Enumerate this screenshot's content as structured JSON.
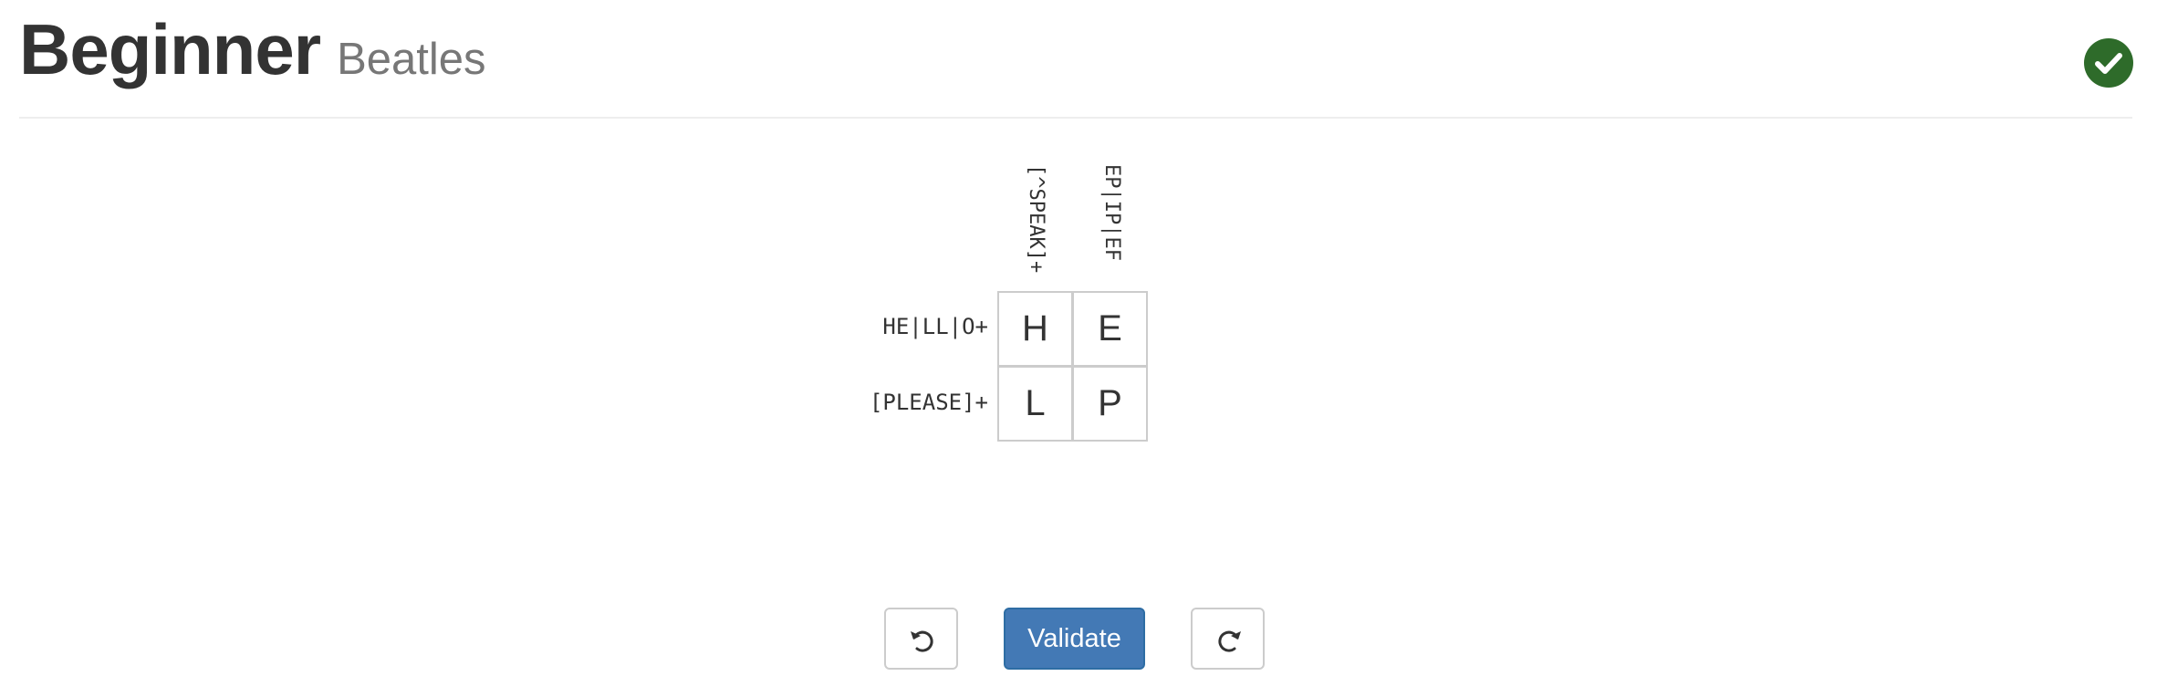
{
  "header": {
    "title": "Beginner",
    "subtitle": "Beatles",
    "status_icon": "check-circle-icon",
    "status_color": "#2e6b2a"
  },
  "puzzle": {
    "column_clues": [
      "[^SPEAK]+",
      "EP|IP|EF"
    ],
    "row_clues": [
      "HE|LL|O+",
      "[PLEASE]+"
    ],
    "cells": [
      [
        "H",
        "E"
      ],
      [
        "L",
        "P"
      ]
    ]
  },
  "controls": {
    "undo_icon": "undo-icon",
    "validate_label": "Validate",
    "redo_icon": "redo-icon",
    "accent_color": "#4379b5"
  }
}
